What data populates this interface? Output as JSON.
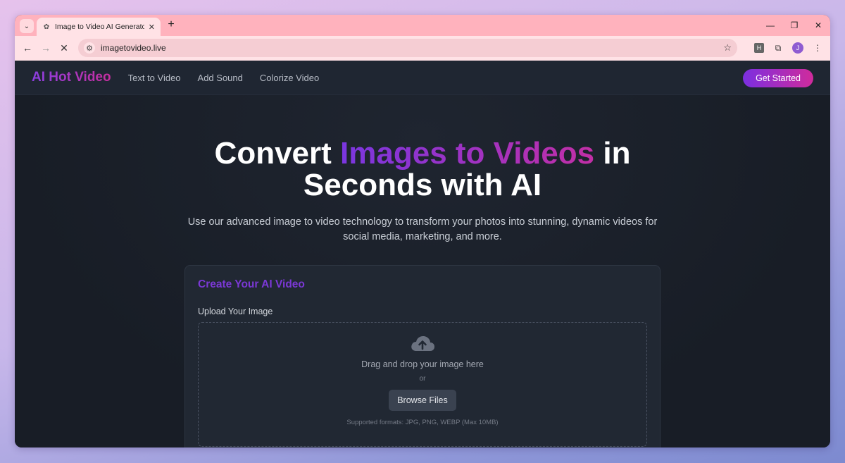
{
  "browser": {
    "tab_title": "Image to Video AI Generator - ",
    "url": "imagetovideo.live",
    "profile_initial": "J",
    "ext_badge": "H"
  },
  "site": {
    "brand": "AI Hot Video",
    "nav": [
      "Text to Video",
      "Add Sound",
      "Colorize Video"
    ],
    "cta": "Get Started"
  },
  "hero": {
    "title_pre": "Convert ",
    "title_highlight": "Images to Videos",
    "title_post": " in",
    "title_line2": "Seconds with AI",
    "subtitle": "Use our advanced image to video technology to transform your photos into stunning, dynamic videos for social media, marketing, and more."
  },
  "card": {
    "title": "Create Your AI Video",
    "upload_label": "Upload Your Image",
    "drop_text": "Drag and drop your image here",
    "or_text": "or",
    "browse_label": "Browse Files",
    "formats": "Supported formats: JPG, PNG, WEBP (Max 10MB)"
  }
}
